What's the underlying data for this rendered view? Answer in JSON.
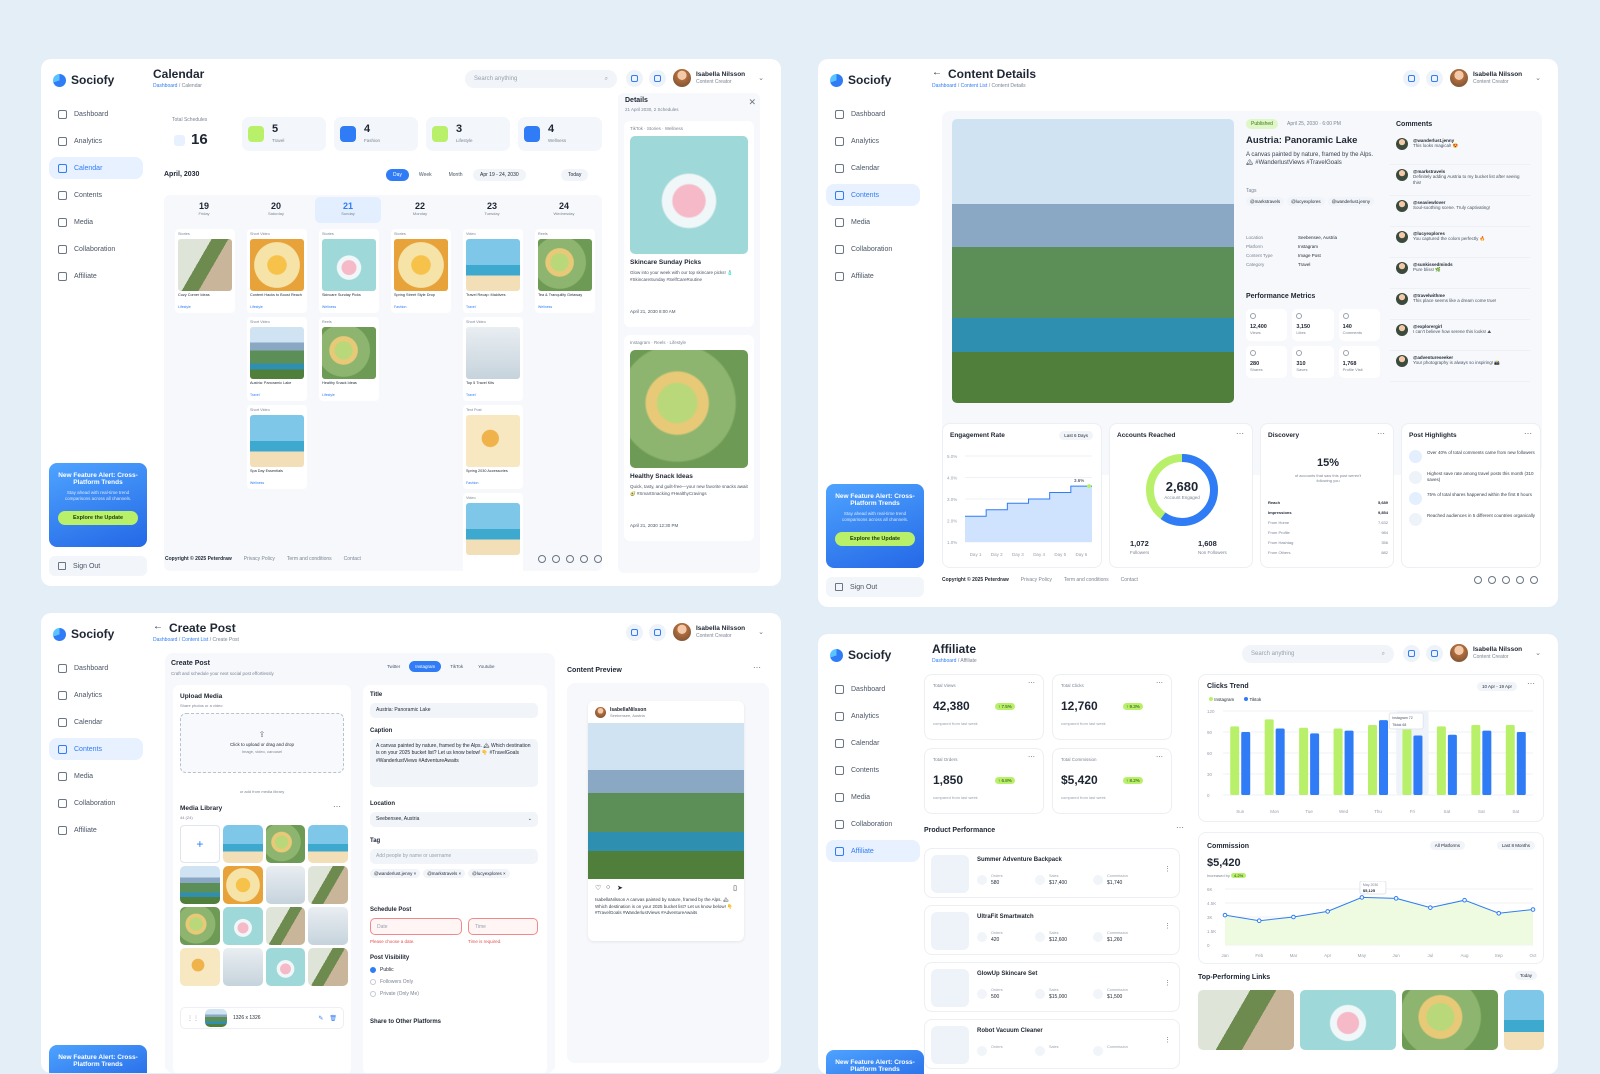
{
  "brand": "Sociofy",
  "user": {
    "name": "Isabella Nilsson",
    "role": "Content Creator"
  },
  "search_placeholder": "Search anything",
  "nav": [
    "Dashboard",
    "Analytics",
    "Calendar",
    "Contents",
    "Media",
    "Collaboration",
    "Affiliate"
  ],
  "promo": {
    "title": "New Feature Alert: Cross-Platform Trends",
    "sub": "Stay ahead with real-time trend comparisons across all channels.",
    "button": "Explore the Update"
  },
  "sign_out": "Sign Out",
  "footer": {
    "copyright": "Copyright © 2025 Peterdraw",
    "links": [
      "Privacy Policy",
      "Term and conditions",
      "Contact"
    ]
  },
  "calendar": {
    "title": "Calendar",
    "crumb_root": "Dashboard",
    "crumb_leaf": "Calendar",
    "total_label": "Total Schedules",
    "total_value": "16",
    "stats": [
      {
        "value": "5",
        "label": "Travel",
        "color": "#b9f06a"
      },
      {
        "value": "4",
        "label": "Fashion",
        "color": "#2f7cf6"
      },
      {
        "value": "3",
        "label": "Lifestyle",
        "color": "#b9f06a"
      },
      {
        "value": "4",
        "label": "Wellness",
        "color": "#2f7cf6"
      }
    ],
    "month": "April, 2030",
    "view_tabs": [
      "Day",
      "Week",
      "Month"
    ],
    "range": "Apr 19 - 24, 2030",
    "today": "Today",
    "days": [
      {
        "num": "19",
        "name": "Friday"
      },
      {
        "num": "20",
        "name": "Saturday"
      },
      {
        "num": "21",
        "name": "Sunday"
      },
      {
        "num": "22",
        "name": "Monday"
      },
      {
        "num": "23",
        "name": "Tuesday"
      },
      {
        "num": "24",
        "name": "Wednesday"
      }
    ],
    "posts": [
      [
        {
          "type": "Stories",
          "title": "Cozy Corner Ideas",
          "cat": "Lifestyle",
          "img": "p-room"
        }
      ],
      [
        {
          "type": "Short Video",
          "title": "Content Hacks to Boost Reach",
          "cat": "Lifestyle",
          "img": "p-warm"
        },
        {
          "type": "Short Video",
          "title": "Austria: Panoramic Lake",
          "cat": "Travel",
          "img": "p-sky"
        },
        {
          "type": "Short Video",
          "title": "Spa Day Essentials",
          "cat": "Wellness",
          "img": "p-beach"
        }
      ],
      [
        {
          "type": "Stories",
          "title": "Skincare Sunday Picks",
          "cat": "Wellness",
          "img": "p-pink"
        },
        {
          "type": "Reels",
          "title": "Healthy Snack Ideas",
          "cat": "Lifestyle",
          "img": "p-food"
        }
      ],
      [
        {
          "type": "Stories",
          "title": "Spring Street Style Drop",
          "cat": "Fashion",
          "img": "p-warm"
        }
      ],
      [
        {
          "type": "Video",
          "title": "Travel Recap: Maldives",
          "cat": "Travel",
          "img": "p-beach"
        },
        {
          "type": "Short Video",
          "title": "Top 5 Travel Kits",
          "cat": "Travel",
          "img": "p-gray"
        },
        {
          "type": "Text Post",
          "title": "Spring 2030 Accessories",
          "cat": "Fashion",
          "img": "p-sand"
        },
        {
          "type": "Video",
          "title": "",
          "cat": "",
          "img": "p-beach"
        }
      ],
      [
        {
          "type": "Reels",
          "title": "Tea & Tranquility Getaway",
          "cat": "Wellness",
          "img": "p-food"
        }
      ]
    ],
    "details": {
      "title": "Details",
      "sub": "21 April 2030, 2 Schedules",
      "items": [
        {
          "platform": "TikTok",
          "type": "Stories",
          "cat": "Wellness",
          "title": "Skincare Sunday Picks",
          "desc": "Glow into your week with our top skincare picks! 🧴 #SkincareSunday #SelfCareRoutine",
          "date": "April 21, 2030",
          "time": "8:00 AM",
          "img": "p-pink"
        },
        {
          "platform": "Instagram",
          "type": "Reels",
          "cat": "Lifestyle",
          "title": "Healthy Snack Ideas",
          "desc": "Quick, tasty, and guilt-free—your new favorite snacks await 🥑 #SmartSnacking #HealthyCravings",
          "date": "April 21, 2030",
          "time": "12:30 PM",
          "img": "p-food"
        }
      ]
    }
  },
  "content": {
    "title": "Content Details",
    "crumb_root": "Dashboard",
    "crumb_mid": "Content List",
    "crumb_leaf": "Content Details",
    "status": "Published",
    "date": "April 25, 2030",
    "time": "6:00 PM",
    "post_title": "Austria: Panoramic Lake",
    "caption": "A canvas painted by nature, framed by the Alps. 🏔 #WanderlustViews #TravelGoals",
    "tags_label": "Tags",
    "tags": [
      "@markstravels",
      "@lucyexplores",
      "@wanderlust.jenny"
    ],
    "meta": [
      {
        "k": "Location",
        "v": "Seebensee, Austria"
      },
      {
        "k": "Platform",
        "v": "Instagram"
      },
      {
        "k": "Content Type",
        "v": "Image Post"
      },
      {
        "k": "Category",
        "v": "Travel"
      }
    ],
    "metrics_title": "Performance Metrics",
    "metrics": [
      {
        "v": "12,400",
        "k": "Views"
      },
      {
        "v": "3,150",
        "k": "Likes"
      },
      {
        "v": "140",
        "k": "Comments"
      },
      {
        "v": "280",
        "k": "Shares"
      },
      {
        "v": "310",
        "k": "Saves"
      },
      {
        "v": "1,768",
        "k": "Profile Visit"
      }
    ],
    "comments_title": "Comments",
    "comments": [
      {
        "u": "@wanderlust.jenny",
        "t": "This looks magical! 😍"
      },
      {
        "u": "@markstravels",
        "t": "Definitely adding Austria to my bucket list after seeing this!"
      },
      {
        "u": "@seaviewlover",
        "t": "Soul-soothing scene. Truly captivating!"
      },
      {
        "u": "@lucyexplores",
        "t": "You captured the colors perfectly 🔥"
      },
      {
        "u": "@sunkissedminds",
        "t": "Pure bliss! 🌿"
      },
      {
        "u": "@travelwithme",
        "t": "This place seems like a dream come true!"
      },
      {
        "u": "@explorergirl",
        "t": "I can't believe how serene this looks! ⛰"
      },
      {
        "u": "@adventureseeker",
        "t": "Your photography is always so inspiring! 📸"
      }
    ],
    "engagement": {
      "title": "Engagement Rate",
      "filter": "Last 6 Days",
      "ticks": [
        "5.0%",
        "4.0%",
        "3.0%",
        "2.0%",
        "1.0%"
      ],
      "days": [
        "Day 1",
        "Day 2",
        "Day 3",
        "Day 4",
        "Day 5",
        "Day 6"
      ],
      "values": [
        2.2,
        2.5,
        2.8,
        3.0,
        3.3,
        3.6
      ],
      "last_label": "3.6%"
    },
    "reach": {
      "title": "Accounts Reached",
      "value": "2,680",
      "label": "Account Engaged",
      "followers": "1,072",
      "followers_label": "Followers",
      "non": "1,608",
      "non_label": "Non Followers",
      "pct_followers": 40
    },
    "discovery": {
      "title": "Discovery",
      "pct": "15%",
      "desc": "of accounts that saw this post weren't following you",
      "rows": [
        {
          "k": "Reach",
          "v": "5,689"
        },
        {
          "k": "Impressions",
          "v": "9,854"
        },
        {
          "k": "From Home",
          "v": "7,632"
        },
        {
          "k": "From Profile",
          "v": "984"
        },
        {
          "k": "From Hashtag",
          "v": "356"
        },
        {
          "k": "From Others",
          "v": "882"
        }
      ]
    },
    "highlights": {
      "title": "Post Highlights",
      "items": [
        "Over 40% of total comments came from new followers",
        "Highest save rate among travel posts this month (310 saves)",
        "75% of total shares happened within the first 8 hours",
        "Reached audiences in 5 different countries organically"
      ]
    }
  },
  "create": {
    "title": "Create Post",
    "crumb_root": "Dashboard",
    "crumb_mid": "Content List",
    "crumb_leaf": "Create Post",
    "form_title": "Create Post",
    "form_sub": "Craft and schedule your next social post effortlessly",
    "platforms": [
      "Twitter",
      "Instagram",
      "TikTok",
      "Youtube"
    ],
    "upload_title": "Upload Media",
    "upload_sub": "Share photos or a video",
    "upload_hint": "Click to upload or drag and drop",
    "upload_types": "Image, video, carousel",
    "or_library": "or add from media library",
    "library_title": "Media Library",
    "library_count": "44 (24)",
    "file_size": "1326 x 1326",
    "title_label": "Title",
    "title_value": "Austria: Panoramic Lake",
    "caption_label": "Caption",
    "caption_value": "A canvas painted by nature, framed by the Alps. 🏔 Which destination is on your 2025 bucket list? Let us know below! 👇 #TravelGoals #WanderlustViews #AdventureAwaits",
    "location_label": "Location",
    "location_value": "Seebensee, Austria",
    "tag_label": "Tag",
    "tag_placeholder": "Add people by name or username",
    "tags": [
      "@wanderlust.jenny",
      "@markstravels",
      "@lucyexplores"
    ],
    "schedule_label": "Schedule Post",
    "date_placeholder": "Date",
    "time_placeholder": "Time",
    "date_error": "Please choose a date.",
    "time_error": "Time is required.",
    "visibility_label": "Post Visibility",
    "visibility": [
      "Public",
      "Followers Only",
      "Private (Only Me)"
    ],
    "share_label": "Share to Other Platforms",
    "preview_title": "Content Preview",
    "preview_user": "IsabellaNilsson",
    "preview_loc": "Seebensee, Austria",
    "preview_caption": "IsabellaNilsson A canvas painted by nature, framed by the Alps. 🏔 Which destination is on your 2025 bucket list? Let us know below! 👇 #TravelGoals #WanderlustViews #AdventureAwaits"
  },
  "affiliate": {
    "title": "Affiliate",
    "crumb_root": "Dashboard",
    "crumb_leaf": "Affiliate",
    "kpis": [
      {
        "label": "Total Views",
        "value": "42,380",
        "delta": "7.5%",
        "sub": "compared from last week"
      },
      {
        "label": "Total Clicks",
        "value": "12,760",
        "delta": "9.3%",
        "sub": "compared from last week"
      },
      {
        "label": "Total Orders",
        "value": "1,850",
        "delta": "6.8%",
        "sub": "compared from last week"
      },
      {
        "label": "Total Commission",
        "value": "$5,420",
        "delta": "8.2%",
        "sub": "compared from last week"
      }
    ],
    "products_title": "Product Performance",
    "products": [
      {
        "name": "Summer Adventure Backpack",
        "orders": "580",
        "sales": "$17,400",
        "commission": "$1,740"
      },
      {
        "name": "UltraFit Smartwatch",
        "orders": "420",
        "sales": "$12,600",
        "commission": "$1,260"
      },
      {
        "name": "GlowUp Skincare Set",
        "orders": "500",
        "sales": "$15,000",
        "commission": "$1,500"
      },
      {
        "name": "Robot Vacuum Cleaner",
        "orders": "",
        "sales": "",
        "commission": ""
      }
    ],
    "orders_label": "Orders",
    "sales_label": "Sales",
    "commission_label": "Commission",
    "commission_title": "Commission",
    "commission_value": "$5,420",
    "commission_delta": "4.2%",
    "commission_sub": "Increased by",
    "commission_filters": [
      "All Platforms",
      "Last 8 Months"
    ],
    "top_links_title": "Top-Performing Links",
    "top_links_filter": "Today"
  },
  "chart_data": [
    {
      "type": "bar",
      "title": "Clicks Trend",
      "filter": "10 Apr - 19 Apr",
      "categories": [
        "Sun",
        "Mon",
        "Tue",
        "Wed",
        "Thu",
        "Fri",
        "Sat",
        "Sat",
        "Sat"
      ],
      "series": [
        {
          "name": "Instagram",
          "color": "#b9f06a",
          "values": [
            98,
            108,
            96,
            95,
            100,
            110,
            98,
            100,
            100
          ]
        },
        {
          "name": "Tiktok",
          "color": "#2f7cf6",
          "values": [
            90,
            95,
            88,
            92,
            107,
            85,
            86,
            92,
            90
          ]
        }
      ],
      "yticks": [
        "120",
        "90",
        "60",
        "30",
        "0"
      ],
      "ylim": [
        0,
        120
      ],
      "tooltip": {
        "ig": "72",
        "tk": "68"
      }
    },
    {
      "type": "line",
      "title": "Commission",
      "categories": [
        "Jan",
        "Feb",
        "Mar",
        "Apr",
        "May",
        "Jun",
        "Jul",
        "Aug",
        "Sep",
        "Oct"
      ],
      "values": [
        3.2,
        2.6,
        3.0,
        3.6,
        5.1,
        5.0,
        4.0,
        4.8,
        3.4,
        3.8
      ],
      "yticks": [
        "6K",
        "4.5K",
        "3K",
        "1.5K",
        "0"
      ],
      "ylim": [
        0,
        6
      ],
      "tooltip": {
        "label": "May 2030",
        "value": "$5,125"
      }
    }
  ]
}
